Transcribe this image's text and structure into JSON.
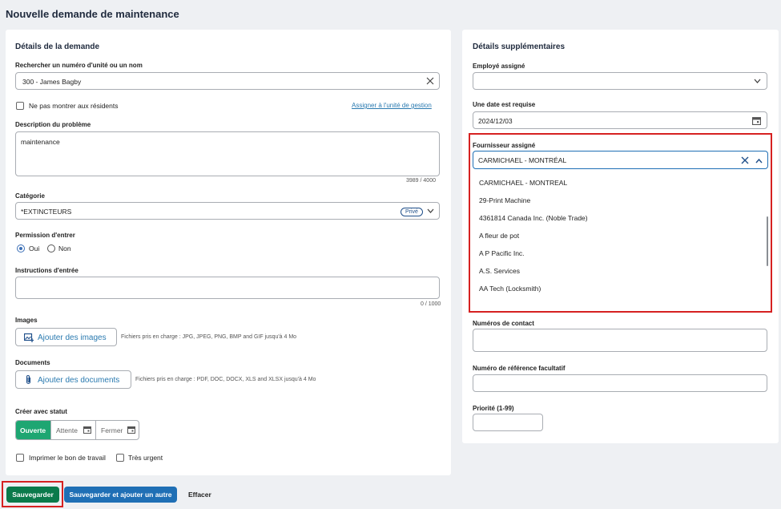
{
  "page": {
    "title": "Nouvelle demande de maintenance"
  },
  "left": {
    "title": "Détails de la demande",
    "search_label": "Rechercher un numéro d'unité ou un nom",
    "search_value": "300 - James Bagby",
    "hide_label": "Ne pas montrer aux résidents",
    "assign_link": "Assigner à l'unité de gestion",
    "desc_label": "Description du problème",
    "desc_value": "maintenance",
    "desc_counter": "3989 / 4000",
    "cat_label": "Catégorie",
    "cat_value": "*EXTINCTEURS",
    "cat_badge": "Privé",
    "perm_label": "Permission d'entrer",
    "perm_yes": "Oui",
    "perm_no": "Non",
    "instr_label": "Instructions d'entrée",
    "instr_counter": "0 / 1000",
    "images_label": "Images",
    "images_btn": "Ajouter des images",
    "images_hint": "Fichiers pris en charge : JPG, JPEG, PNG, BMP and GIF jusqu'à 4 Mo",
    "docs_label": "Documents",
    "docs_btn": "Ajouter des documents",
    "docs_hint": "Fichiers pris en charge : PDF, DOC, DOCX, XLS and XLSX jusqu'à 4 Mo",
    "status_label": "Créer avec statut",
    "status_open": "Ouverte",
    "status_wait": "Attente",
    "status_close": "Fermer",
    "print_label": "Imprimer le bon de travail",
    "urgent_label": "Très urgent"
  },
  "right": {
    "title": "Détails supplémentaires",
    "emp_label": "Employé assigné",
    "emp_value": "",
    "date_label": "Une date est requise",
    "date_value": "2024/12/03",
    "vendor_label": "Fournisseur assigné",
    "vendor_value": "CARMICHAEL - MONTRÉAL",
    "vendor_options": [
      "CARMICHAEL - MONTREAL",
      "29-Print Machine",
      "4361814 Canada Inc. (Noble Trade)",
      "A fleur de pot",
      "A P Pacific Inc.",
      "A.S. Services",
      "AA Tech (Locksmith)"
    ],
    "contact_label": "Numéros de contact",
    "ref_label": "Numéro de référence facultatif",
    "prio_label": "Priorité (1-99)"
  },
  "footer": {
    "save": "Sauvegarder",
    "save_add": "Sauvegarder et ajouter un autre",
    "clear": "Effacer"
  },
  "colors": {
    "accent": "#2a7ab0",
    "save_green": "#0b7a4b",
    "status_green": "#1ea672",
    "primary_blue": "#1f6fb5",
    "highlight_red": "#d62121"
  }
}
